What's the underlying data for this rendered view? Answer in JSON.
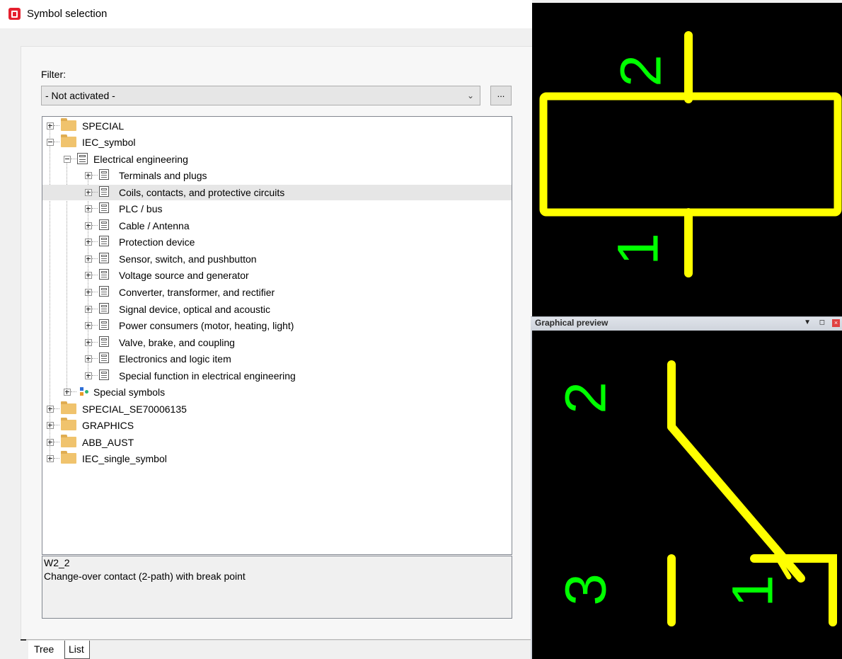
{
  "window": {
    "title": "Symbol selection"
  },
  "filter": {
    "label": "Filter:",
    "value": "- Not activated -",
    "more_button": "..."
  },
  "tree": {
    "roots": [
      {
        "label": "SPECIAL",
        "expanded": false
      },
      {
        "label": "IEC_symbol",
        "expanded": true
      },
      {
        "label": "SPECIAL_SE70006135",
        "expanded": false
      },
      {
        "label": "GRAPHICS",
        "expanded": false
      },
      {
        "label": "ABB_AUST",
        "expanded": false
      },
      {
        "label": "IEC_single_symbol",
        "expanded": false
      }
    ],
    "electrical_engineering": "Electrical engineering",
    "categories": [
      "Terminals and plugs",
      "Coils, contacts, and protective circuits",
      "PLC / bus",
      "Cable / Antenna",
      "Protection device",
      "Sensor, switch, and pushbutton",
      "Voltage source and generator",
      "Converter, transformer, and rectifier",
      "Signal device, optical and acoustic",
      "Power consumers (motor, heating, light)",
      "Valve, brake, and coupling",
      "Electronics and logic item",
      "Special function in electrical engineering"
    ],
    "selected_category": "Coils, contacts, and protective circuits",
    "special_symbols": "Special symbols"
  },
  "description": {
    "code": "W2_2",
    "text": "Change-over contact (2-path) with break point"
  },
  "tabs": {
    "tree": "Tree",
    "list": "List",
    "active": "Tree"
  },
  "preview": {
    "title": "Graphical preview",
    "top_labels": {
      "upper": "2",
      "lower": "1"
    },
    "bottom_labels": {
      "left_upper": "2",
      "left_lower": "3",
      "right": "1"
    },
    "symbol_color": "#ffff00",
    "label_color": "#00ff00",
    "background": "#000000"
  },
  "colors": {
    "app_icon": "#e5202e",
    "selection": "#e6e6e6",
    "folder": "#f0c36d"
  }
}
